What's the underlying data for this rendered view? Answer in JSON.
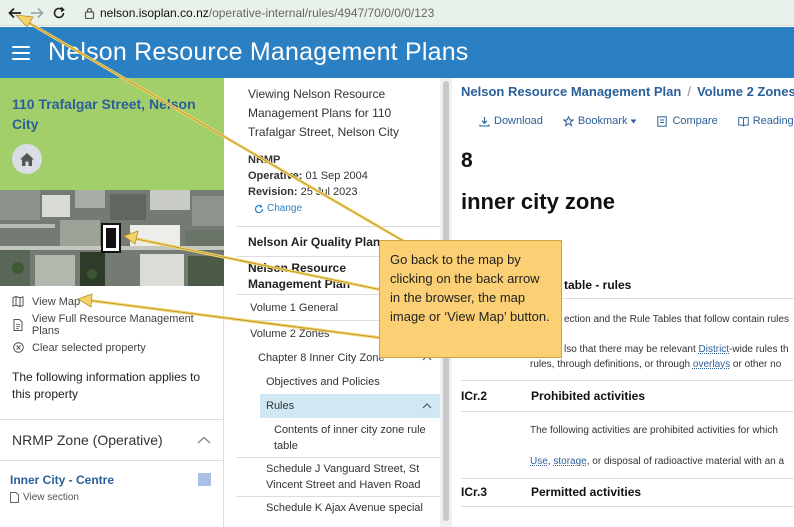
{
  "browser": {
    "url_host": "nelson.isoplan.co.nz",
    "url_path": "/operative-internal/rules/4947/70/0/0/0/123"
  },
  "header": {
    "title": "Nelson Resource Management Plans"
  },
  "left": {
    "address": "110 Trafalgar Street, Nelson City",
    "links": [
      "View Map",
      "View Full Resource Management Plans",
      "Clear selected property"
    ],
    "info": "The following information applies to this property",
    "zone_heading": "NRMP Zone (Operative)",
    "zone_name": "Inner City - Centre",
    "zone_color": "#aabfe6",
    "view_section": "View section"
  },
  "middle": {
    "viewing": "Viewing Nelson Resource Management Plans for 110 Trafalgar Street, Nelson City",
    "plan_code": "NRMP",
    "operative_label": "Operative:",
    "operative_date": "01 Sep 2004",
    "revision_label": "Revision:",
    "revision_date": "25 Jul 2023",
    "change": "Change",
    "air_plan": "Nelson Air Quality Plan",
    "rm_plan": "Nelson Resource Management Plan",
    "vol1": "Volume 1 General",
    "vol2": "Volume 2 Zones",
    "chapter8": "Chapter 8 Inner City Zone",
    "objectives": "Objectives and Policies",
    "rules": "Rules",
    "contents": "Contents of inner city zone rule table",
    "schedule_j": "Schedule J Vanguard Street, St Vincent Street and Haven Road",
    "schedule_k": "Schedule K Ajax Avenue special"
  },
  "right": {
    "crumb1": "Nelson Resource Management Plan",
    "crumb_sep": "/",
    "crumb2": "Volume 2 Zones",
    "toolbar": [
      "Download",
      "Bookmark",
      "Compare",
      "Reading mode"
    ],
    "chapter_number": "8",
    "chapter_name": "inner city zone",
    "sec1_title": "table - rules",
    "sec1_text1": "ection and the Rule Tables that follow contain rules",
    "sec1_text2a": "lso that there may be relevant",
    "sec1_link1": "District",
    "sec1_text2b": "-wide rules th",
    "sec1_text3a": "rules, through definitions, or through",
    "sec1_link2": "overlays",
    "sec1_text3b": "or other no",
    "sec2_code": "ICr.2",
    "sec2_title": "Prohibited activities",
    "sec2_text": "The following activities are prohibited activities for which",
    "sec2_link1": "Use",
    "sec2_comma": ",",
    "sec2_link2": "storage",
    "sec2_text2": ", or disposal of radioactive material with an a",
    "sec3_code": "ICr.3",
    "sec3_title": "Permitted activities"
  },
  "callout": {
    "text": "Go back to the map by clicking on the back arrow in the browser, the map image or ‘View Map’ button."
  },
  "colors": {
    "header_blue": "#2b7fc3",
    "address_green": "#a3cf6b",
    "link_blue": "#2a5f99",
    "callout_fill": "#fbd075",
    "arrow": "#f4d36b"
  }
}
